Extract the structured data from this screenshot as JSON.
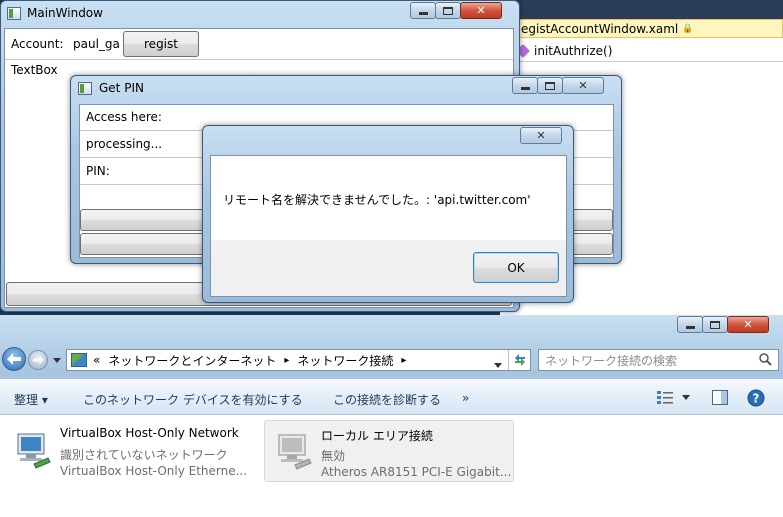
{
  "editor": {
    "tab_label": "egistAccountWindow.xaml",
    "lock_glyph": "🔒",
    "member_label": "initAuthrize()"
  },
  "main_window": {
    "title": "MainWindow",
    "account_label": "Account:",
    "account_value": "paul_ga",
    "regist_label": "regist",
    "textbox_label": "TextBox"
  },
  "pin_window": {
    "title": "Get PIN",
    "rows": [
      "Access here:",
      "processing...",
      "PIN:"
    ]
  },
  "dialog": {
    "message": "リモート名を解決できませんでした。: 'api.twitter.com'",
    "ok_label": "OK",
    "close_glyph": "✕"
  },
  "explorer": {
    "breadcrumb": {
      "prefix": "«",
      "items": [
        "ネットワークとインターネット",
        "ネットワーク接続"
      ],
      "sep": "▸"
    },
    "search_placeholder": "ネットワーク接続の検索",
    "commands": [
      "整理 ▾",
      "このネットワーク デバイスを有効にする",
      "この接続を診断する",
      "»"
    ],
    "connections": [
      {
        "name": "VirtualBox Host-Only Network",
        "status": "識別されていないネットワーク",
        "device": "VirtualBox Host-Only Etherne..."
      },
      {
        "name": "ローカル エリア接続",
        "status": "無効",
        "device": "Atheros AR8151 PCI-E Gigabit..."
      }
    ],
    "caption_glyphs": {
      "close": "✕"
    }
  },
  "colors": {
    "aero_frame": "#a9c6e2",
    "close_red": "#c03a22",
    "link_text": "#1e395b"
  }
}
